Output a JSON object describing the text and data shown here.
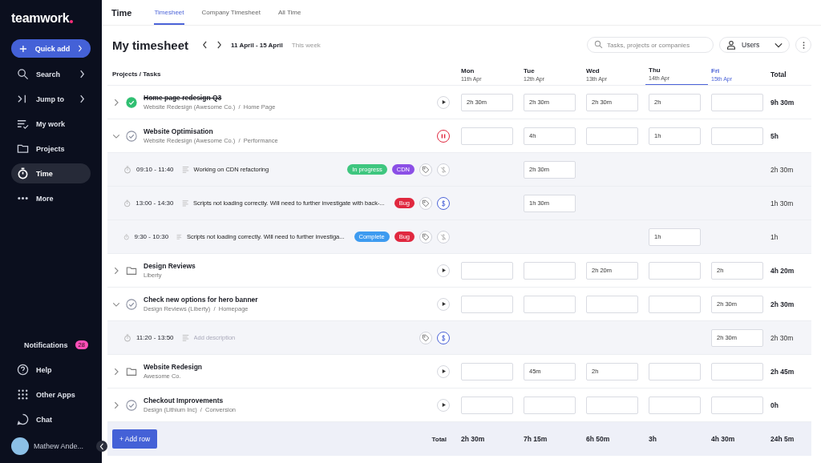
{
  "sidebar": {
    "logo": "teamwork",
    "quick_add": "Quick add",
    "items": [
      {
        "label": "Search",
        "arrow": true,
        "selected": false
      },
      {
        "label": "Jump to",
        "arrow": true,
        "selected": false
      },
      {
        "label": "My work",
        "arrow": false,
        "selected": false
      },
      {
        "label": "Projects",
        "arrow": false,
        "selected": false
      },
      {
        "label": "Time",
        "arrow": false,
        "selected": true
      },
      {
        "label": "More",
        "arrow": false,
        "selected": false
      }
    ],
    "bottom_items": [
      {
        "label": "Notifications",
        "badge": "28"
      },
      {
        "label": "Help"
      },
      {
        "label": "Other Apps"
      },
      {
        "label": "Chat"
      }
    ],
    "user": {
      "name": "Mathew Ande..."
    }
  },
  "header": {
    "title": "Time",
    "tabs": [
      {
        "label": "Timesheet",
        "selected": true
      },
      {
        "label": "Company Timesheet",
        "selected": false
      },
      {
        "label": "All Time",
        "selected": false
      }
    ]
  },
  "toolbar": {
    "title": "My timesheet",
    "range": "11 April - 15 April",
    "range_note": "This week",
    "search": {
      "placeholder": "Tasks, projects or companies"
    },
    "users": "Users"
  },
  "table": {
    "first_column": "Projects / Tasks",
    "total_column": "Total",
    "days": [
      {
        "name": "Mon",
        "date": "11th Apr",
        "today": false,
        "selected": false
      },
      {
        "name": "Tue",
        "date": "12th Apr",
        "today": false,
        "selected": false
      },
      {
        "name": "Wed",
        "date": "13th Apr",
        "today": false,
        "selected": false
      },
      {
        "name": "Thu",
        "date": "14th Apr",
        "today": false,
        "selected": true
      },
      {
        "name": "Fri",
        "date": "15th Apr",
        "today": true,
        "selected": false
      }
    ],
    "rows": [
      {
        "kind": "task",
        "title": "Home page redesign Q3",
        "subtitle": "Website Redesign (Awesome Co.)  /  Home Page",
        "completed": true,
        "expanded": false,
        "running": false,
        "cells": [
          "2h 30m",
          "2h 30m",
          "2h 30m",
          "2h",
          null
        ],
        "total": "9h 30m"
      },
      {
        "kind": "task",
        "title": "Website Optimisation",
        "subtitle": "Website Redesign (Awesome Co.)  /  Performance",
        "completed": false,
        "expanded": true,
        "running": true,
        "cells": [
          null,
          "4h",
          null,
          "1h",
          null
        ],
        "total": "5h"
      },
      {
        "kind": "entry",
        "time": "09:10 - 11:40",
        "description": "Working on CDN refactoring",
        "tags": [
          {
            "label": "In progress",
            "color": "#3ec67f"
          },
          {
            "label": "CDN",
            "color": "#8b4fe6"
          }
        ],
        "billable": false,
        "cells": [
          null,
          "2h 30m",
          null,
          null,
          null
        ],
        "total": "2h 30m"
      },
      {
        "kind": "entry",
        "time": "13:00 - 14:30",
        "description": "Scripts not loading correctly. Will need to further investigate with back-...",
        "tags": [
          {
            "label": "Bug",
            "color": "#e0283f"
          }
        ],
        "billable": true,
        "cells": [
          null,
          "1h 30m",
          null,
          null,
          null
        ],
        "total": "1h 30m"
      },
      {
        "kind": "entry",
        "time": "9:30 - 10:30",
        "description": "Scripts not loading correctly. Will need to further investiga...",
        "tags": [
          {
            "label": "Complete",
            "color": "#3d9bf0"
          },
          {
            "label": "Bug",
            "color": "#e0283f"
          }
        ],
        "billable": false,
        "cells": [
          null,
          null,
          null,
          "1h",
          null
        ],
        "total": "1h"
      },
      {
        "kind": "project",
        "title": "Design Reviews",
        "subtitle": "Liberty",
        "expanded": false,
        "running": false,
        "cells": [
          null,
          null,
          "2h 20m",
          null,
          "2h"
        ],
        "total": "4h 20m"
      },
      {
        "kind": "task",
        "title": "Check new options for hero banner",
        "subtitle": "Design Reviews (Liberty)  /  Homepage",
        "completed": false,
        "expanded": true,
        "running": false,
        "cells": [
          null,
          null,
          null,
          null,
          "2h 30m"
        ],
        "total": "2h 30m"
      },
      {
        "kind": "entry",
        "time": "11:20 - 13:50",
        "placeholder": "Add description",
        "billable": true,
        "cells": [
          null,
          null,
          null,
          null,
          "2h 30m"
        ],
        "total": "2h 30m"
      },
      {
        "kind": "project",
        "title": "Website Redesign",
        "subtitle": "Awesome Co.",
        "expanded": false,
        "running": false,
        "cells": [
          null,
          "45m",
          "2h",
          null,
          null
        ],
        "total": "2h 45m"
      },
      {
        "kind": "task",
        "title": "Checkout Improvements",
        "subtitle": "Design (Lithium Inc)  /  Conversion",
        "completed": false,
        "expanded": false,
        "running": false,
        "cells": [
          null,
          null,
          null,
          null,
          null
        ],
        "total": "0h"
      }
    ],
    "footer": {
      "add_row": "+ Add row",
      "label": "Total",
      "day_totals": [
        "2h 30m",
        "7h 15m",
        "6h 50m",
        "3h",
        "4h 30m"
      ],
      "total": "24h 5m"
    }
  }
}
